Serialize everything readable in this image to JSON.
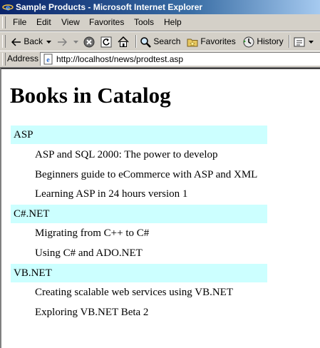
{
  "window": {
    "title": "Sample Products - Microsoft Internet Explorer"
  },
  "menu": [
    "File",
    "Edit",
    "View",
    "Favorites",
    "Tools",
    "Help"
  ],
  "toolbar": {
    "back": "Back",
    "search": "Search",
    "favorites": "Favorites",
    "history": "History"
  },
  "address": {
    "label": "Address",
    "url": "http://localhost/news/prodtest.asp"
  },
  "page": {
    "title": "Books in Catalog",
    "categories": [
      {
        "name": "ASP",
        "products": [
          "ASP and SQL 2000: The power to develop",
          "Beginners guide to eCommerce with ASP and XML",
          "Learning ASP in 24 hours version 1"
        ]
      },
      {
        "name": "C#.NET",
        "products": [
          "Migrating from C++ to C#",
          "Using C# and ADO.NET"
        ]
      },
      {
        "name": "VB.NET",
        "products": [
          "Creating scalable web services using VB.NET",
          "Exploring VB.NET Beta 2"
        ]
      }
    ]
  },
  "colors": {
    "category_background": "#ccffff",
    "titlebar_start": "#0a246a",
    "titlebar_end": "#a6caf0"
  }
}
